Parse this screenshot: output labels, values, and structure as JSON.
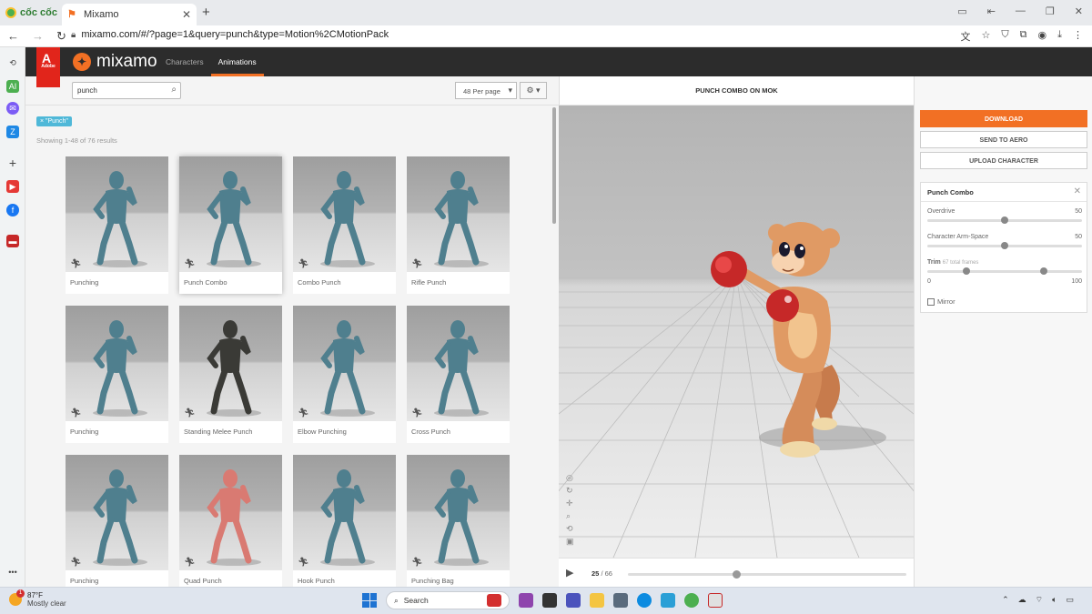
{
  "browser": {
    "brand": "cốc cốc",
    "tab_title": "Mixamo",
    "url": "mixamo.com/#/?page=1&query=punch&type=Motion%2CMotionPack"
  },
  "header": {
    "adobe": "Adobe",
    "logo": "mixamo",
    "tabs": [
      {
        "label": "Characters",
        "active": false
      },
      {
        "label": "Animations",
        "active": true
      }
    ]
  },
  "search": {
    "value": "punch",
    "per_page": "48 Per page",
    "filter_tag": "× \"Punch\"",
    "results_text": "Showing 1-48 of 76 results"
  },
  "grid": [
    {
      "label": "Punching",
      "model": "blue",
      "selected": false
    },
    {
      "label": "Punch Combo",
      "model": "blue",
      "selected": true
    },
    {
      "label": "Combo Punch",
      "model": "blue",
      "selected": false
    },
    {
      "label": "Rifle Punch",
      "model": "blue",
      "selected": false
    },
    {
      "label": "Punching",
      "model": "blue",
      "selected": false
    },
    {
      "label": "Standing Melee Punch",
      "model": "dark",
      "selected": false
    },
    {
      "label": "Elbow Punching",
      "model": "blue",
      "selected": false
    },
    {
      "label": "Cross Punch",
      "model": "blue",
      "selected": false
    },
    {
      "label": "Punching",
      "model": "blue",
      "selected": false
    },
    {
      "label": "Quad Punch",
      "model": "pink",
      "selected": false
    },
    {
      "label": "Hook Punch",
      "model": "blue",
      "selected": false
    },
    {
      "label": "Punching Bag",
      "model": "blue",
      "selected": false
    }
  ],
  "viewer": {
    "title": "PUNCH COMBO ON MOK",
    "current_frame": "25",
    "total_frames": "/ 66",
    "progress": 0.39
  },
  "actions": {
    "download": "DOWNLOAD",
    "send_to_aero": "SEND TO AERO",
    "upload_character": "UPLOAD CHARACTER"
  },
  "settings": {
    "title": "Punch Combo",
    "overdrive_label": "Overdrive",
    "overdrive_value": "50",
    "overdrive_fraction": 0.5,
    "armspace_label": "Character Arm-Space",
    "armspace_value": "50",
    "armspace_fraction": 0.5,
    "trim_label": "Trim",
    "trim_note": "67 total frames",
    "trim_min": "0",
    "trim_max": "100",
    "trim_start_fraction": 0.25,
    "trim_end_fraction": 0.75,
    "mirror_label": "Mirror"
  },
  "taskbar": {
    "temp": "87°F",
    "weather": "Mostly clear",
    "search": "Search"
  },
  "colors": {
    "accent": "#f27024",
    "tag": "#4fb8d8",
    "adobe_red": "#e1251b"
  }
}
